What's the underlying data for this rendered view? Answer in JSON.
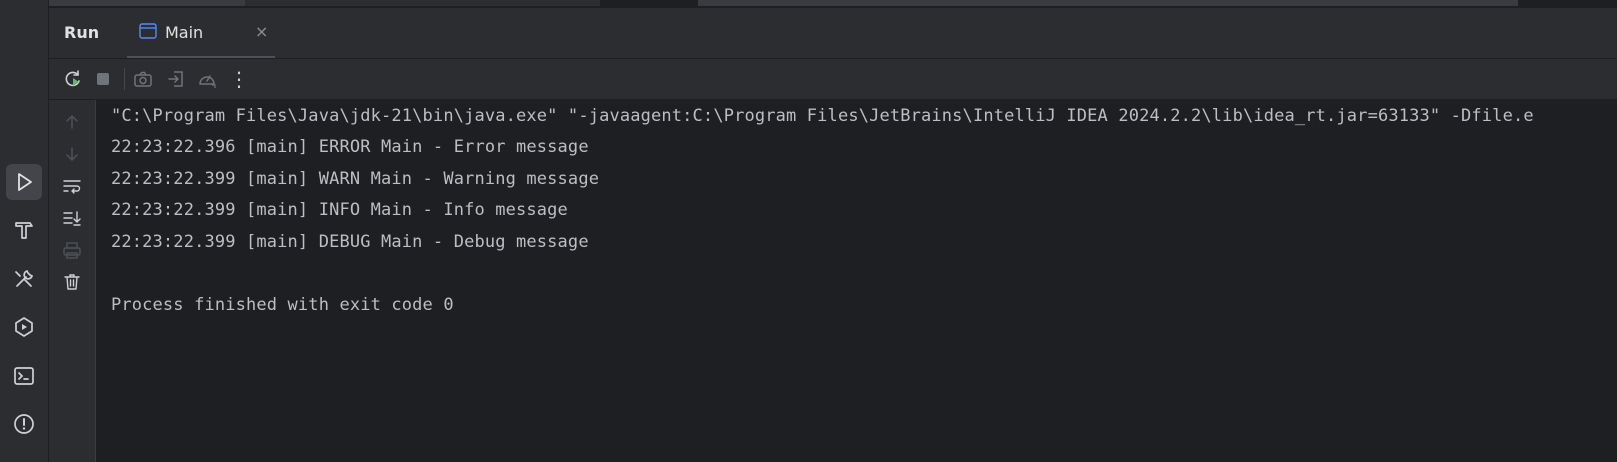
{
  "panel": {
    "title": "Run",
    "tab": {
      "label": "Main",
      "close": "×"
    }
  },
  "left_rail": {
    "items": [
      {
        "name": "run-tool-icon",
        "active": true
      },
      {
        "name": "build-hammer-icon"
      },
      {
        "name": "services-tools-icon"
      },
      {
        "name": "debug-services-icon"
      },
      {
        "name": "terminal-icon"
      },
      {
        "name": "problems-icon"
      }
    ]
  },
  "toolbar": {
    "icons": [
      "rerun-icon",
      "stop-icon",
      "camera-icon",
      "exit-icon",
      "profiler-icon",
      "more-options-icon"
    ],
    "more": "⋮"
  },
  "side_tools": {
    "icons": [
      "scroll-up-icon",
      "scroll-down-icon",
      "soft-wrap-icon",
      "scroll-to-end-icon",
      "print-icon",
      "clear-all-icon"
    ]
  },
  "console": {
    "lines": [
      "\"C:\\Program Files\\Java\\jdk-21\\bin\\java.exe\" \"-javaagent:C:\\Program Files\\JetBrains\\IntelliJ IDEA 2024.2.2\\lib\\idea_rt.jar=63133\" -Dfile.e",
      "22:23:22.396 [main] ERROR Main - Error message",
      "22:23:22.399 [main] WARN Main - Warning message",
      "22:23:22.399 [main] INFO Main - Info message",
      "22:23:22.399 [main] DEBUG Main - Debug message",
      "",
      "Process finished with exit code 0"
    ]
  },
  "colors": {
    "background": "#1e1f22",
    "panel": "#2b2d30",
    "text": "#bcbec4",
    "accent_green": "#5fb865",
    "accent_blue": "#548af7"
  }
}
